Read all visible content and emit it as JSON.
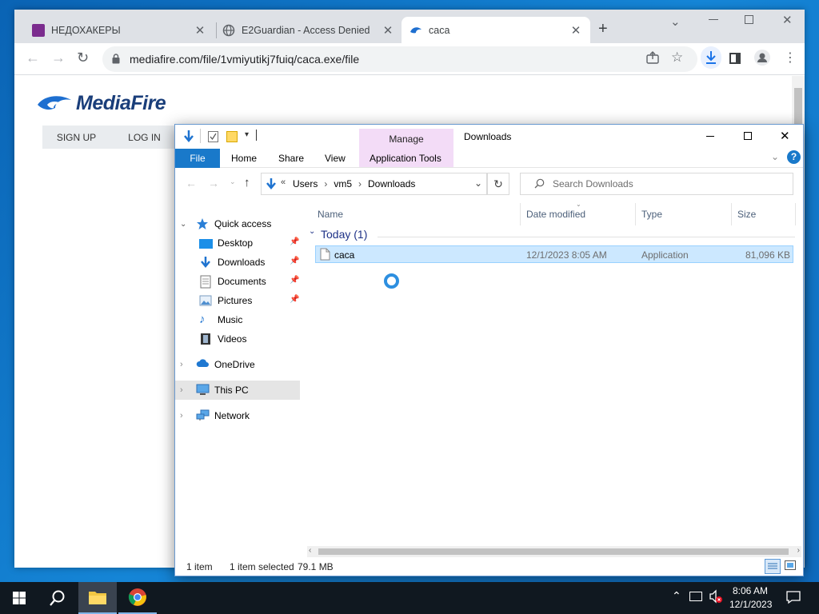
{
  "browser": {
    "tabs": [
      {
        "title": "НЕДОХАКЕРЫ"
      },
      {
        "title": "E2Guardian - Access Denied"
      },
      {
        "title": "caca"
      }
    ],
    "url": "mediafire.com/file/1vmiyutikj7fuiq/caca.exe/file"
  },
  "mediafire": {
    "logo_text": "MediaFire",
    "nav": {
      "signup": "SIGN UP",
      "login": "LOG IN"
    }
  },
  "explorer": {
    "title": "Downloads",
    "context_tab": "Manage",
    "ribbon_tabs": [
      "File",
      "Home",
      "Share",
      "View",
      "Application Tools"
    ],
    "breadcrumb": {
      "overflow": "«",
      "parts": [
        "Users",
        "vm5",
        "Downloads"
      ]
    },
    "search_placeholder": "Search Downloads",
    "nav": {
      "quick_access": "Quick access",
      "desktop": "Desktop",
      "downloads": "Downloads",
      "documents": "Documents",
      "pictures": "Pictures",
      "music": "Music",
      "videos": "Videos",
      "onedrive": "OneDrive",
      "this_pc": "This PC",
      "network": "Network"
    },
    "columns": {
      "name": "Name",
      "date": "Date modified",
      "type": "Type",
      "size": "Size"
    },
    "group": "Today (1)",
    "files": [
      {
        "name": "caca",
        "date": "12/1/2023 8:05 AM",
        "type": "Application",
        "size": "81,096 KB"
      }
    ],
    "status": {
      "count": "1 item",
      "selected": "1 item selected",
      "size": "79.1 MB"
    }
  },
  "taskbar": {
    "time": "8:06 AM",
    "date": "12/1/2023"
  }
}
